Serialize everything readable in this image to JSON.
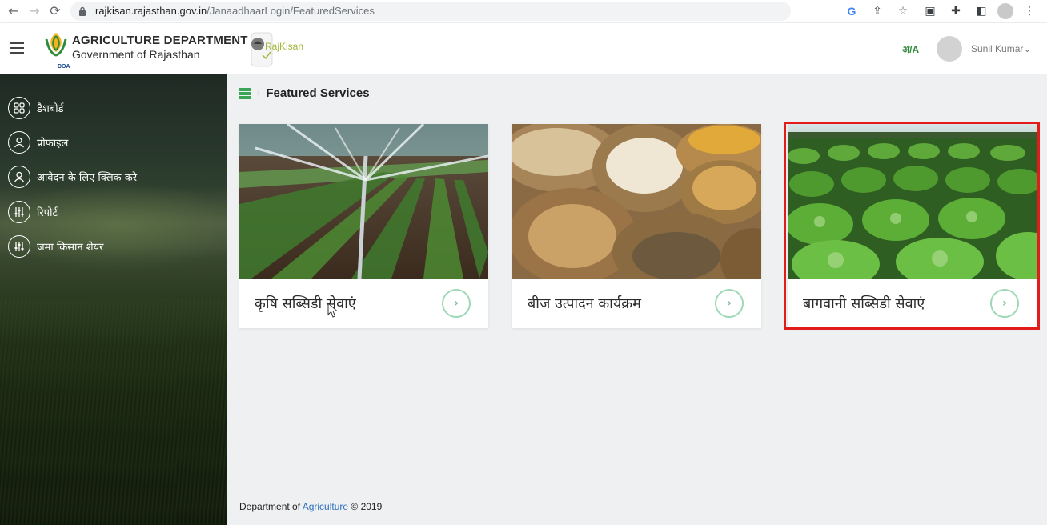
{
  "browser": {
    "url_host": "rajkisan.rajasthan.gov.in",
    "url_path": "/JanaadhaarLogin/FeaturedServices"
  },
  "header": {
    "dept_title": "AGRICULTURE DEPARTMENT",
    "dept_subtitle": "Government of Rajasthan",
    "logo_badge": "DOA",
    "rajkisan_label": "RajKisan",
    "lang_toggle": "अ/A",
    "user_name": "Sunil Kumar",
    "user_chevron": "⌄"
  },
  "sidebar": {
    "items": [
      {
        "label": "डैशबोर्ड",
        "icon": "dashboard-icon"
      },
      {
        "label": "प्रोफाइल",
        "icon": "profile-icon"
      },
      {
        "label": "आवेदन के लिए क्लिक करे",
        "icon": "apply-icon"
      },
      {
        "label": "रिपोर्ट",
        "icon": "report-icon"
      },
      {
        "label": "जमा किसान शेयर",
        "icon": "share-icon"
      }
    ]
  },
  "main": {
    "title": "Featured Services",
    "cards": [
      {
        "label": "कृषि सब्सिडी सेवाएं",
        "image": "irrigation-sprinkler-field"
      },
      {
        "label": "बीज उत्पादन कार्यक्रम",
        "image": "seed-sacks"
      },
      {
        "label": "बागवानी सब्सिडी सेवाएं",
        "image": "cabbage-field",
        "highlighted": true
      }
    ],
    "go_symbol": "›"
  },
  "footer": {
    "prefix": "Department of ",
    "accent": "Agriculture",
    "suffix": " © 2019"
  },
  "colors": {
    "accent_green": "#3aa655",
    "highlight_red": "#e21b1b",
    "footer_link": "#2e6fbf"
  }
}
